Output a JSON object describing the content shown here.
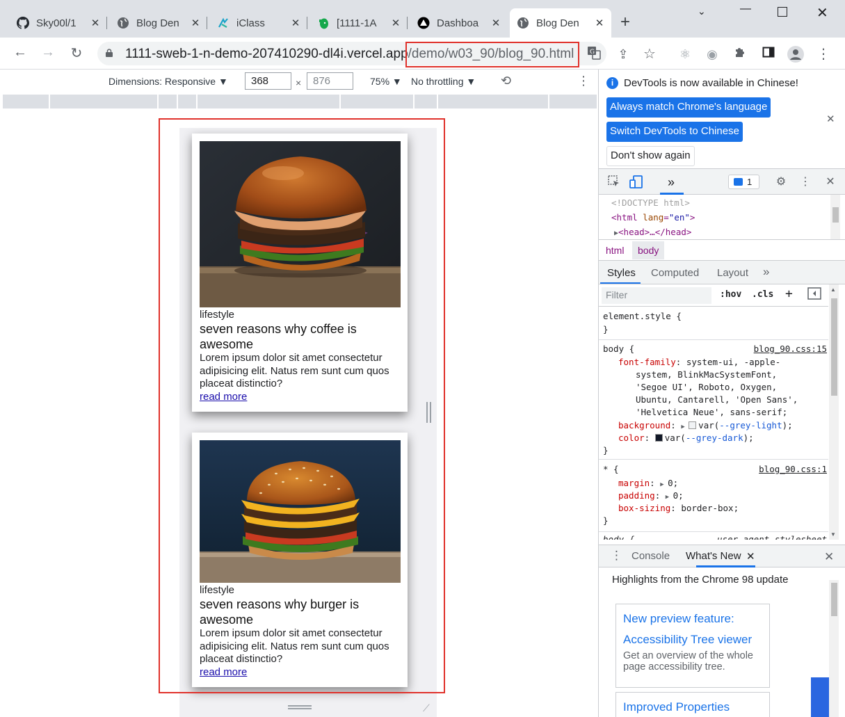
{
  "tabs": [
    {
      "title": "Sky00l/1",
      "icon": "github-icon"
    },
    {
      "title": "Blog Den",
      "icon": "globe-icon"
    },
    {
      "title": "iClass",
      "icon": "iclass-icon"
    },
    {
      "title": "[1111-1A",
      "icon": "evernote-icon"
    },
    {
      "title": "Dashboa",
      "icon": "vercel-icon"
    },
    {
      "title": "Blog Den",
      "icon": "globe-icon",
      "active": true
    }
  ],
  "address": {
    "host": "1111-sweb-1-n-demo-207410290-dl4i.vercel.app",
    "path": "/demo/w03_90/blog_90.html"
  },
  "device_toolbar": {
    "dimensions_label": "Dimensions: Responsive ▼",
    "width": "368",
    "times": "×",
    "height_placeholder": "876",
    "zoom": "75% ▼",
    "throttling": "No throttling ▼"
  },
  "cards": [
    {
      "category": "lifestyle",
      "title": "seven reasons why coffee is awesome",
      "body": "Lorem ipsum dolor sit amet consectetur adipisicing elit. Natus rem sunt cum quos placeat distinctio?",
      "link": "read more"
    },
    {
      "category": "lifestyle",
      "title": "seven reasons why burger is awesome",
      "body": "Lorem ipsum dolor sit amet consectetur adipisicing elit. Natus rem sunt cum quos placeat distinctio?",
      "link": "read more"
    }
  ],
  "devtools": {
    "info_message": "DevTools is now available in Chinese!",
    "btn_match": "Always match Chrome's language",
    "btn_switch": "Switch DevTools to Chinese",
    "btn_dont_show": "Don't show again",
    "message_count": "1",
    "dom": {
      "doctype": "<!DOCTYPE html>",
      "html_open": "<html",
      "lang_attr": "lang",
      "lang_val": "\"en\"",
      "head": "<head>…</head>"
    },
    "breadcrumbs": [
      "html",
      "body"
    ],
    "style_tabs": [
      "Styles",
      "Computed",
      "Layout"
    ],
    "filter_placeholder": "Filter",
    "hov": ":hov",
    "cls": ".cls",
    "rules": {
      "element_style": "element.style {",
      "body_selector": "body {",
      "body_source": "blog_90.css:15",
      "font_family_name": "font-family",
      "font_family_lines": [
        "system-ui, -apple-",
        "system, BlinkMacSystemFont,",
        "'Segoe UI', Roboto, Oxygen,",
        "Ubuntu, Cantarell, 'Open Sans',",
        "'Helvetica Neue', sans-serif;"
      ],
      "background_name": "background",
      "background_val": "--grey-light",
      "color_name": "color",
      "color_val": "--grey-dark",
      "star_selector": "* {",
      "star_source": "blog_90.css:1",
      "margin_name": "margin",
      "margin_val": "0;",
      "padding_name": "padding",
      "padding_val": "0;",
      "boxsizing_name": "box-sizing",
      "boxsizing_val": "border-box;",
      "ua_selector": "body {",
      "ua_source": "user agent stylesheet"
    },
    "drawer_tabs": [
      "Console",
      "What's New"
    ],
    "highlights": "Highlights from the Chrome 98 update",
    "whats_new": [
      {
        "title1": "New preview feature:",
        "title2": "Accessibility Tree viewer",
        "desc": "Get an overview of the whole page accessibility tree."
      },
      {
        "title1": "Improved Properties"
      }
    ]
  },
  "colors": {
    "highlight_red": "#e0312b",
    "accent_blue": "#1a73e8"
  }
}
